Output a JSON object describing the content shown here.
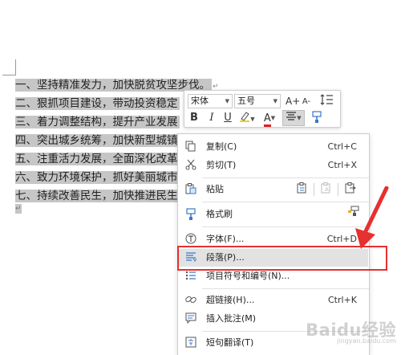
{
  "document": {
    "lines": [
      "一、坚持精准发力，加快脱贫攻坚步伐。",
      "二、狠抓项目建设，带动投资稳定",
      "三、着力调整结构，提升产业发展",
      "四、突出城乡统筹，加快新型城镇化发展",
      "五、注重活力发展，全面深化改革",
      "六、致力环境保护，抓好美丽城市",
      "七、持续改善民生，加快推进民生"
    ],
    "paragraph_mark": "↵"
  },
  "mini_toolbar": {
    "font_name": "宋体",
    "font_size": "五号",
    "grow_font": "A+",
    "shrink_font": "A-",
    "bold": "B",
    "italic": "I",
    "underline": "U",
    "font_color": "A",
    "font_color_value": "#e02020"
  },
  "context_menu": {
    "items": [
      {
        "label": "复制(C)",
        "shortcut": "Ctrl+C",
        "icon": "copy-icon"
      },
      {
        "label": "剪切(T)",
        "shortcut": "Ctrl+X",
        "icon": "scissors-icon"
      },
      {
        "label": "粘贴",
        "shortcut": "",
        "icon": "paste-icon"
      },
      {
        "label": "格式刷",
        "shortcut": "",
        "icon": "format-painter-icon"
      },
      {
        "label": "字体(F)...",
        "shortcut": "Ctrl+D",
        "icon": "font-icon"
      },
      {
        "label": "段落(P)...",
        "shortcut": "",
        "icon": "paragraph-icon"
      },
      {
        "label": "项目符号和编号(N)...",
        "shortcut": "",
        "icon": "bullets-icon"
      },
      {
        "label": "超链接(H)...",
        "shortcut": "Ctrl+K",
        "icon": "link-icon"
      },
      {
        "label": "插入批注(M)",
        "shortcut": "",
        "icon": "comment-icon"
      },
      {
        "label": "短句翻译(T)",
        "shortcut": "",
        "icon": "translate-icon"
      }
    ],
    "highlighted_index": 5
  },
  "annotation_color": "#e63030",
  "watermark": {
    "text": "Baidu经验",
    "sub": "jingyan.baidu.com"
  }
}
